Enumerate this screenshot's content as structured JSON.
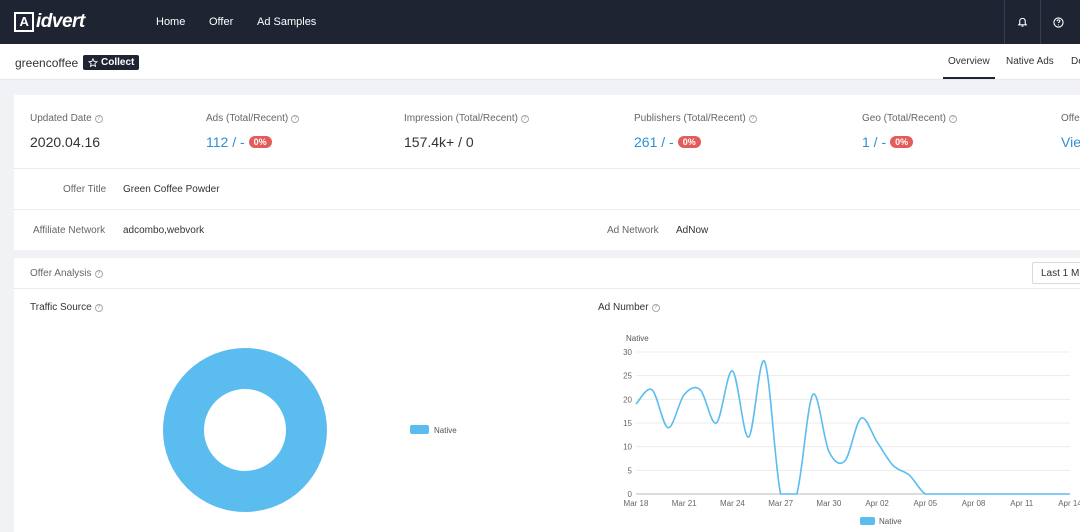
{
  "header": {
    "logo_text": "idvert",
    "logo_mark": "A",
    "nav": [
      "Home",
      "Offer",
      "Ad Samples"
    ],
    "icons": [
      "bell-icon",
      "help-icon"
    ]
  },
  "subheader": {
    "name": "greencoffee",
    "collect_label": "Collect",
    "tabs": [
      "Overview",
      "Native Ads",
      "De"
    ]
  },
  "stats": [
    {
      "label": "Updated Date",
      "value": "2020.04.16",
      "link": false,
      "badge": ""
    },
    {
      "label": "Ads (Total/Recent)",
      "value": "112 / -",
      "link": true,
      "badge": "0%"
    },
    {
      "label": "Impression (Total/Recent)",
      "value": "157.4k+ / 0",
      "link": false,
      "badge": ""
    },
    {
      "label": "Publishers (Total/Recent)",
      "value": "261 / -",
      "link": true,
      "badge": "0%"
    },
    {
      "label": "Geo (Total/Recent)",
      "value": "1 / -",
      "link": true,
      "badge": "0%"
    },
    {
      "label": "Offe",
      "value": "Vie",
      "link": true,
      "badge": ""
    }
  ],
  "info": {
    "offer_title_label": "Offer Title",
    "offer_title_value": "Green Coffee Powder",
    "affiliate_label": "Affiliate Network",
    "affiliate_value": "adcombo,webvork",
    "ad_network_label": "Ad Network",
    "ad_network_value": "AdNow"
  },
  "analysis": {
    "title": "Offer Analysis",
    "range": "Last 1 M",
    "traffic_title": "Traffic Source",
    "ad_number_title": "Ad Number"
  },
  "colors": {
    "accent": "#5bbcf0",
    "link": "#2d8fd6",
    "badge": "#e45b5b",
    "header_bg": "#1f2433"
  },
  "chart_data": [
    {
      "type": "pie",
      "donut": true,
      "labels": [
        "Native"
      ],
      "values": [
        100
      ],
      "legend": "right"
    },
    {
      "type": "line",
      "series_label": "Native",
      "ylabel": "Native",
      "ylim": [
        0,
        30
      ],
      "yticks": [
        0,
        5,
        10,
        15,
        20,
        25,
        30
      ],
      "xticks": [
        "Mar 18",
        "Mar 21",
        "Mar 24",
        "Mar 27",
        "Mar 30",
        "Apr 02",
        "Apr 05",
        "Apr 08",
        "Apr 11",
        "Apr 14"
      ],
      "x": [
        "Mar 18",
        "Mar 19",
        "Mar 20",
        "Mar 21",
        "Mar 22",
        "Mar 23",
        "Mar 24",
        "Mar 25",
        "Mar 26",
        "Mar 27",
        "Mar 28",
        "Mar 29",
        "Mar 30",
        "Mar 31",
        "Apr 01",
        "Apr 02",
        "Apr 03",
        "Apr 04",
        "Apr 05",
        "Apr 06",
        "Apr 07",
        "Apr 08",
        "Apr 09",
        "Apr 10",
        "Apr 11",
        "Apr 12",
        "Apr 13",
        "Apr 14"
      ],
      "series": [
        {
          "name": "Native",
          "values": [
            19,
            22,
            14,
            21,
            22,
            15,
            26,
            12,
            28,
            0,
            0,
            21,
            9,
            7,
            16,
            11,
            6,
            4,
            0,
            0,
            0,
            0,
            0,
            0,
            0,
            0,
            0,
            0
          ]
        }
      ],
      "legend": "bottom",
      "grid": true
    }
  ]
}
